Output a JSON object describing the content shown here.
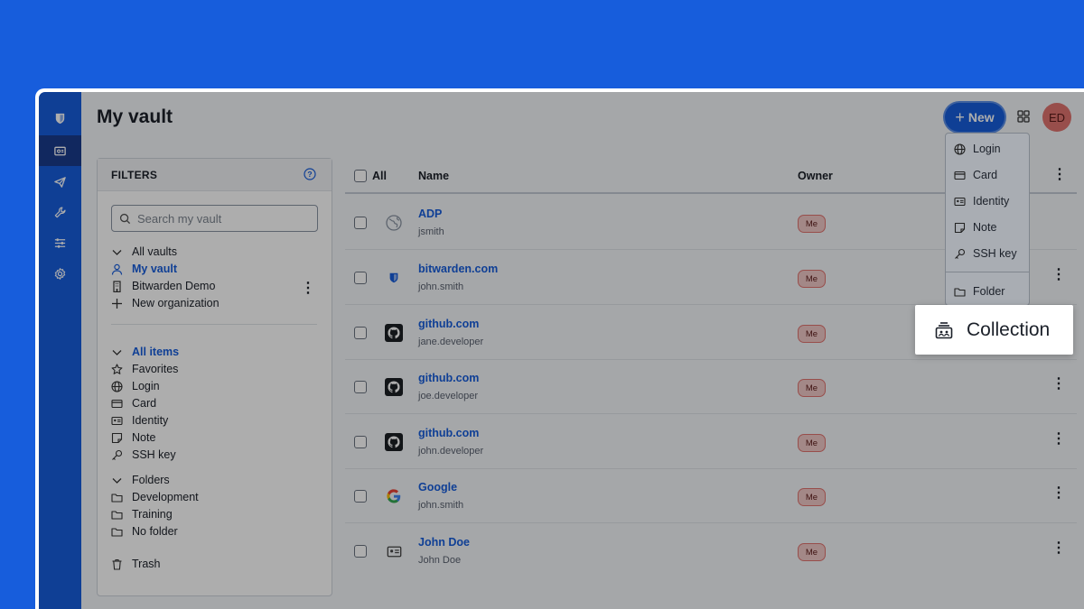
{
  "page": {
    "title": "My vault"
  },
  "header": {
    "new_label": "New",
    "avatar_initials": "ED"
  },
  "filters": {
    "title": "FILTERS",
    "search_placeholder": "Search my vault",
    "vaults": [
      {
        "label": "All vaults",
        "icon": "chevron-down-icon"
      },
      {
        "label": "My vault",
        "icon": "user-icon"
      },
      {
        "label": "Bitwarden Demo",
        "icon": "building-icon"
      },
      {
        "label": "New organization",
        "icon": "plus-icon"
      }
    ],
    "types": [
      {
        "label": "All items",
        "icon": "chevron-down-icon"
      },
      {
        "label": "Favorites",
        "icon": "star-icon"
      },
      {
        "label": "Login",
        "icon": "globe-icon"
      },
      {
        "label": "Card",
        "icon": "credit-card-icon"
      },
      {
        "label": "Identity",
        "icon": "id-card-icon"
      },
      {
        "label": "Note",
        "icon": "note-icon"
      },
      {
        "label": "SSH key",
        "icon": "key-icon"
      }
    ],
    "folders": [
      {
        "label": "Folders",
        "icon": "chevron-down-icon"
      },
      {
        "label": "Development",
        "icon": "folder-icon"
      },
      {
        "label": "Training",
        "icon": "folder-icon"
      },
      {
        "label": "No folder",
        "icon": "folder-icon"
      }
    ],
    "trash": "Trash"
  },
  "table": {
    "col_all": "All",
    "col_name": "Name",
    "col_owner": "Owner",
    "rows": [
      {
        "name": "ADP",
        "user": "jsmith",
        "owner": "Me",
        "icon": "globe-icon"
      },
      {
        "name": "bitwarden.com",
        "user": "john.smith",
        "owner": "Me",
        "icon": "bitwarden-shield-icon"
      },
      {
        "name": "github.com",
        "user": "jane.developer",
        "owner": "Me",
        "icon": "github-icon"
      },
      {
        "name": "github.com",
        "user": "joe.developer",
        "owner": "Me",
        "icon": "github-icon"
      },
      {
        "name": "github.com",
        "user": "john.developer",
        "owner": "Me",
        "icon": "github-icon"
      },
      {
        "name": "Google",
        "user": "john.smith",
        "owner": "Me",
        "icon": "google-icon"
      },
      {
        "name": "John Doe",
        "user": "John Doe",
        "owner": "Me",
        "icon": "id-card-icon"
      }
    ]
  },
  "new_menu": {
    "items": [
      {
        "label": "Login",
        "icon": "globe-icon"
      },
      {
        "label": "Card",
        "icon": "credit-card-icon"
      },
      {
        "label": "Identity",
        "icon": "id-card-icon"
      },
      {
        "label": "Note",
        "icon": "note-icon"
      },
      {
        "label": "SSH key",
        "icon": "key-icon"
      },
      {
        "label": "Folder",
        "icon": "folder-icon"
      }
    ],
    "highlighted": {
      "label": "Collection",
      "icon": "collection-icon"
    }
  },
  "colors": {
    "brand": "#175DDC",
    "nav_active": "#1A3B8C",
    "avatar": "#E0736F"
  }
}
